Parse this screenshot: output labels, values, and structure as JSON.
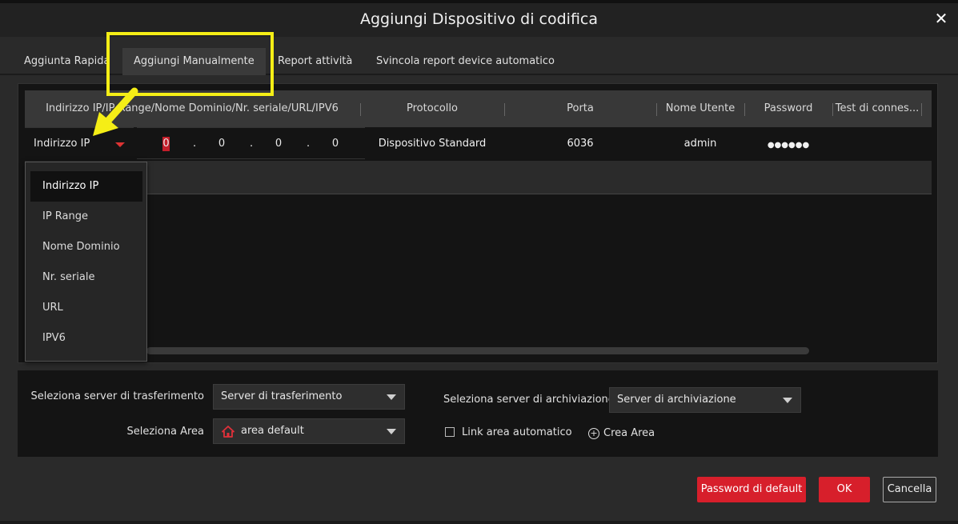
{
  "window": {
    "title": "Aggiungi Dispositivo di codifica",
    "close_glyph": "✕"
  },
  "tabs": [
    {
      "label": "Aggiunta Rapida",
      "active": false
    },
    {
      "label": "Aggiungi Manualmente",
      "active": true
    },
    {
      "label": "Report attività",
      "active": false
    },
    {
      "label": "Svincola report device automatico",
      "active": false
    }
  ],
  "table": {
    "headers": [
      "Indirizzo IP/IP Range/Nome Dominio/Nr. seriale/URL/IPV6",
      "Protocollo",
      "Porta",
      "Nome Utente",
      "Password",
      "Test di connes..."
    ],
    "row": {
      "address_type": "Indirizzo IP",
      "ip_octets": [
        "0",
        "0",
        "0",
        "0"
      ],
      "protocol": "Dispositivo Standard",
      "port": "6036",
      "username": "admin",
      "password": "●●●●●●"
    }
  },
  "address_type_dropdown": {
    "options": [
      "Indirizzo IP",
      "IP Range",
      "Nome Dominio",
      "Nr. seriale",
      "URL",
      "IPV6"
    ],
    "selected": "Indirizzo IP"
  },
  "form": {
    "transfer_label": "Seleziona server di trasferimento",
    "transfer_value": "Server di trasferimento",
    "area_label": "Seleziona Area",
    "area_value": "area default",
    "archive_label": "Seleziona server di archiviazione",
    "archive_value": "Server di archiviazione",
    "auto_link_label": "Link area automatico",
    "create_area_label": "Crea Area"
  },
  "buttons": {
    "default_password": "Password di default",
    "ok": "OK",
    "cancel": "Cancella"
  },
  "colors": {
    "accent": "#d71f2b",
    "annotation": "#f5ee16"
  },
  "icons": {
    "close": "close-icon",
    "home": "home-icon",
    "plus": "plus-circle-icon",
    "annotation_arrow": "arrow-icon"
  }
}
